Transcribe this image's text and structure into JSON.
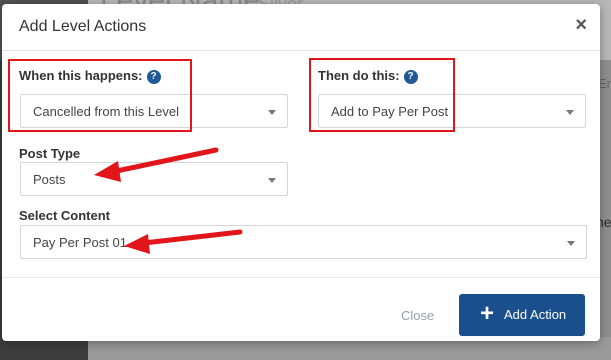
{
  "background": {
    "heading": "Level Name",
    "heading_2": "Silver",
    "right_text": "ne",
    "right_text_2": "Er"
  },
  "modal": {
    "title": "Add Level Actions",
    "close_symbol": "×"
  },
  "when": {
    "label": "When this happens:",
    "help": "?",
    "value": "Cancelled from this Level"
  },
  "then": {
    "label": "Then do this:",
    "help": "?",
    "value": "Add to Pay Per Post"
  },
  "post_type": {
    "label": "Post Type",
    "value": "Posts"
  },
  "content": {
    "label": "Select Content",
    "value": "Pay Per Post 01"
  },
  "footer": {
    "close_label": "Close",
    "add_icon": "+",
    "add_label": "Add Action"
  },
  "colors": {
    "primary": "#1a4f8d",
    "help_icon": "#1f5a96",
    "annotation_red": "#e2151b"
  },
  "icons": [
    "help-icon",
    "chevron-down-icon",
    "close-icon",
    "plus-icon",
    "arrow-annotation"
  ]
}
